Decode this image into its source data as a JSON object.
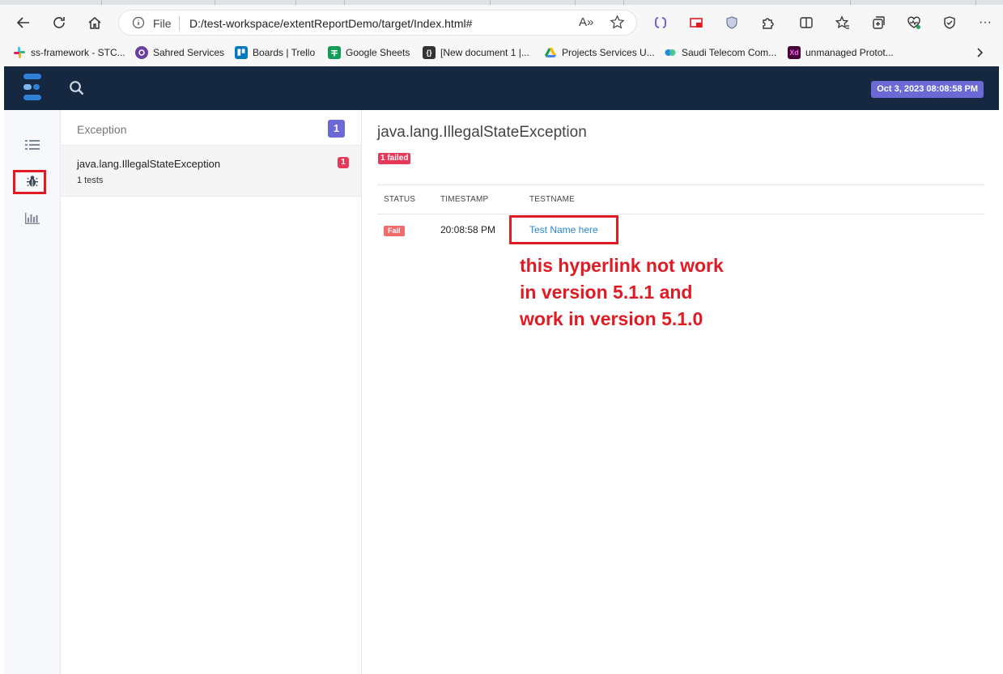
{
  "browser": {
    "protocol_label": "File",
    "url": "D:/test-workspace/extentReportDemo/target/Index.html#",
    "read_aloud_label": "A»",
    "menu_label": "···",
    "bookmarks": [
      {
        "label": "ss-framework - STC...",
        "icon": "slack-icon",
        "color": "#e01e5a"
      },
      {
        "label": "Sahred Services",
        "icon": "shared-services-icon",
        "color": "#6b3fa0"
      },
      {
        "label": "Boards | Trello",
        "icon": "trello-icon",
        "color": "#0079bf"
      },
      {
        "label": "Google Sheets",
        "icon": "sheets-icon",
        "color": "#0f9d58"
      },
      {
        "label": "[New document 1 |...",
        "icon": "braces-icon",
        "color": "#333333"
      },
      {
        "label": "Projects Services U...",
        "icon": "drive-icon",
        "color": "#f4b400"
      },
      {
        "label": "Saudi Telecom Com...",
        "icon": "webex-icon",
        "color": "#1d8be2"
      },
      {
        "label": "unmanaged Protot...",
        "icon": "xd-icon",
        "color": "#470137"
      }
    ],
    "bookmark_glyphs": {
      "braces": "{}",
      "xd": "Xd"
    }
  },
  "navbar": {
    "date": "Oct 3, 2023 08:08:58 PM"
  },
  "list": {
    "title": "Exception",
    "count": "1",
    "item": {
      "name": "java.lang.IllegalStateException",
      "sub": "1 tests",
      "badge": "1"
    }
  },
  "detail": {
    "title": "java.lang.IllegalStateException",
    "failed_badge": "1 failed",
    "columns": [
      "STATUS",
      "TIMESTAMP",
      "TESTNAME"
    ],
    "row": {
      "status": "Fail",
      "timestamp": "20:08:58 PM",
      "testname": "Test Name here"
    }
  },
  "annotation": {
    "lines": [
      "this hyperlink not work",
      "in version 5.1.1 and",
      "work in version 5.1.0"
    ],
    "color": "#e01b24"
  },
  "colors": {
    "navbar": "#16283f",
    "accent": "#6b69d6",
    "danger": "#e8385a",
    "link": "#2a86d4"
  }
}
